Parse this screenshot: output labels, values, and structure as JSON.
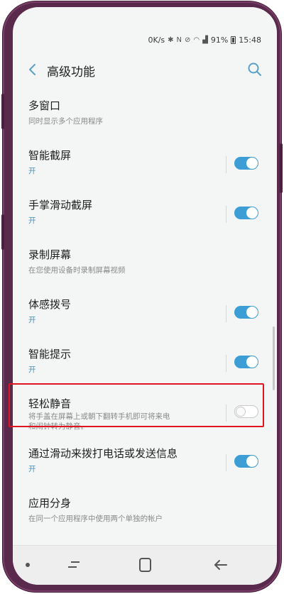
{
  "status_bar": {
    "speed": "0K/s",
    "battery": "91%",
    "time": "15:48"
  },
  "header": {
    "title": "高级功能"
  },
  "settings": [
    {
      "title": "多窗口",
      "subtitle": "同时显示多个应用程序",
      "toggle": null
    },
    {
      "title": "智能截屏",
      "subtitle": "开",
      "toggle": true
    },
    {
      "title": "手掌滑动截屏",
      "subtitle": "开",
      "toggle": true
    },
    {
      "title": "录制屏幕",
      "subtitle": "在您使用设备时录制屏幕视频",
      "toggle": null
    },
    {
      "title": "体感拨号",
      "subtitle": "开",
      "toggle": true
    },
    {
      "title": "智能提示",
      "subtitle": "开",
      "toggle": true
    },
    {
      "title": "轻松静音",
      "subtitle_line1": "将手盖在屏幕上或朝下翻转手机即可将来电",
      "subtitle_line2": "和闹钟转为静音。",
      "toggle": false
    },
    {
      "title": "通过滑动来拨打电话或发送信息",
      "subtitle": "开",
      "toggle": true
    },
    {
      "title": "应用分身",
      "subtitle": "在同一个应用程序中使用两个单独的帐户",
      "toggle": null
    }
  ],
  "colors": {
    "accent": "#3d9ed6",
    "highlight": "#e0151f",
    "frame": "#5a2a4c"
  }
}
